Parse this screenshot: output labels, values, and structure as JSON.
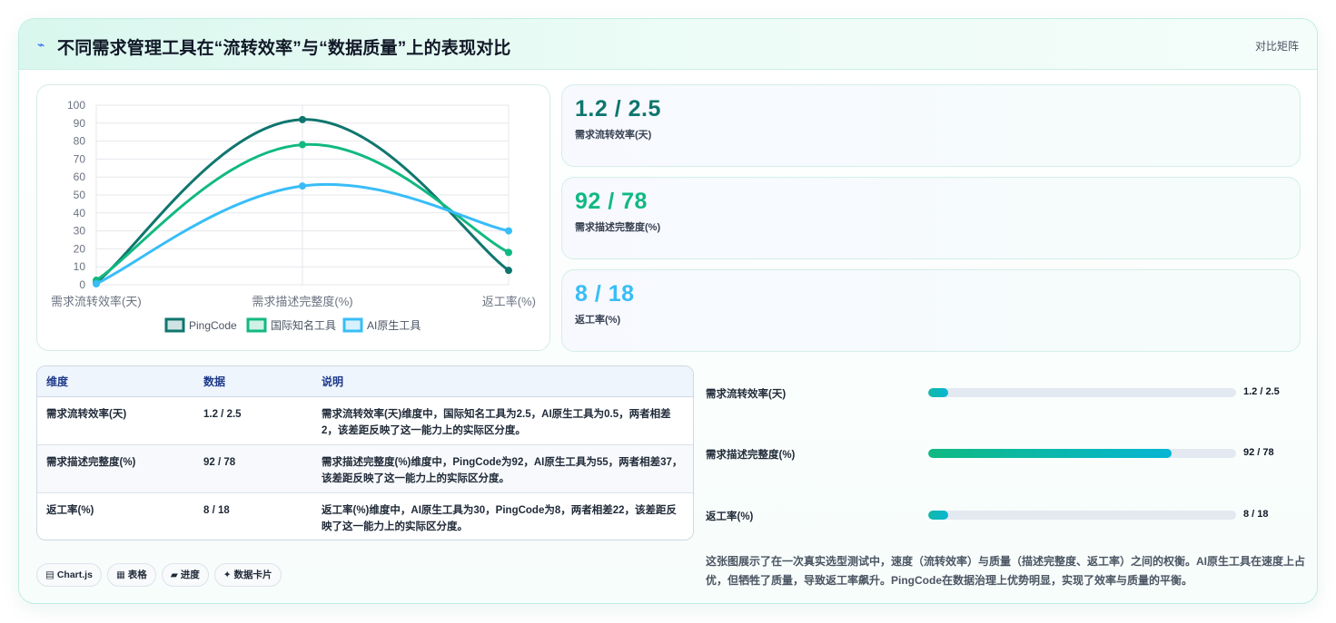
{
  "header": {
    "icon": "bolt-icon",
    "title": "不同需求管理工具在“流转效率”与“数据质量”上的表现对比",
    "tag": "对比矩阵"
  },
  "chart_data": {
    "type": "line",
    "categories": [
      "需求流转效率(天)",
      "需求描述完整度(%)",
      "返工率(%)"
    ],
    "series": [
      {
        "name": "PingCode",
        "color": "#0f766e",
        "values": [
          1.2,
          92,
          8
        ]
      },
      {
        "name": "国际知名工具",
        "color": "#10b981",
        "values": [
          2.5,
          78,
          18
        ]
      },
      {
        "name": "AI原生工具",
        "color": "#38bdf8",
        "values": [
          0.5,
          55,
          30
        ]
      }
    ],
    "ylim": [
      0,
      100
    ],
    "yticks": [
      "0",
      "10",
      "20",
      "30",
      "40",
      "50",
      "60",
      "70",
      "80",
      "90",
      "100"
    ],
    "grid": true,
    "legend": "bottom"
  },
  "kpis": [
    {
      "value": "1.2 / 2.5",
      "label": "需求流转效率(天)",
      "color": "#0f766e"
    },
    {
      "value": "92 / 78",
      "label": "需求描述完整度(%)",
      "color": "#10b981"
    },
    {
      "value": "8 / 18",
      "label": "返工率(%)",
      "color": "#38bdf8"
    }
  ],
  "table": {
    "headers": [
      "维度",
      "数据",
      "说明"
    ],
    "rows": [
      [
        "需求流转效率(天)",
        "1.2 / 2.5",
        "需求流转效率(天)维度中，国际知名工具为2.5，AI原生工具为0.5，两者相差2，该差距反映了这一能力上的实际区分度。"
      ],
      [
        "需求描述完整度(%)",
        "92 / 78",
        "需求描述完整度(%)维度中，PingCode为92，AI原生工具为55，两者相差37，该差距反映了这一能力上的实际区分度。"
      ],
      [
        "返工率(%)",
        "8 / 18",
        "返工率(%)维度中，AI原生工具为30，PingCode为8，两者相差22，该差距反映了这一能力上的实际区分度。"
      ]
    ]
  },
  "bars": [
    {
      "label": "需求流转效率(天)",
      "value": "1.2 / 2.5",
      "fraction": 0.065
    },
    {
      "label": "需求描述完整度(%)",
      "value": "92 / 78",
      "fraction": 0.79
    },
    {
      "label": "返工率(%)",
      "value": "8 / 18",
      "fraction": 0.065
    }
  ],
  "pills": [
    "Chart.js",
    "表格",
    "进度",
    "数据卡片"
  ],
  "description": "这张图展示了在一次真实选型测试中，速度（流转效率）与质量（描述完整度、返工率）之间的权衡。AI原生工具在速度上占优，但牺牲了质量，导致返工率飙升。PingCode在数据治理上优势明显，实现了效率与质量的平衡。"
}
